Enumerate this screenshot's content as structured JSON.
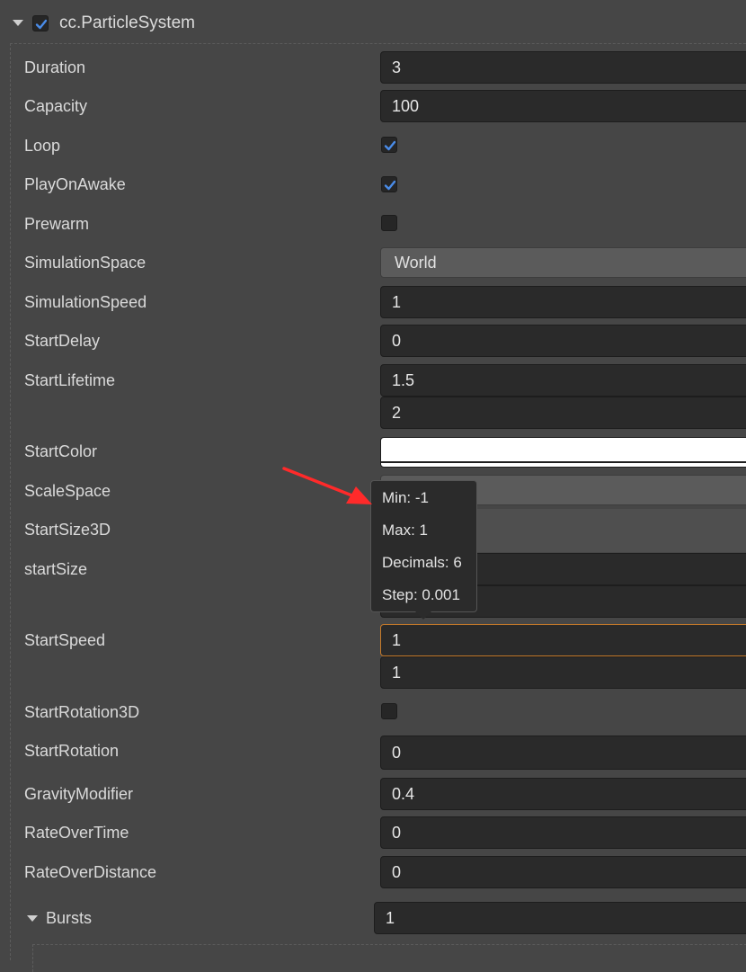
{
  "component": {
    "title": "cc.ParticleSystem",
    "enabled": true
  },
  "properties": {
    "duration": {
      "label": "Duration",
      "value": "3"
    },
    "capacity": {
      "label": "Capacity",
      "value": "100"
    },
    "loop": {
      "label": "Loop",
      "checked": true
    },
    "play_on_awake": {
      "label": "PlayOnAwake",
      "checked": true
    },
    "prewarm": {
      "label": "Prewarm",
      "checked": false
    },
    "simulation_space": {
      "label": "SimulationSpace",
      "value": "World"
    },
    "simulation_speed": {
      "label": "SimulationSpeed",
      "value": "1"
    },
    "start_delay": {
      "label": "StartDelay",
      "value": "0"
    },
    "start_lifetime": {
      "label": "StartLifetime",
      "min": "1.5",
      "max": "2"
    },
    "start_color": {
      "label": "StartColor",
      "color": "#ffffff"
    },
    "scale_space": {
      "label": "ScaleSpace"
    },
    "start_size_3d": {
      "label": "StartSize3D"
    },
    "start_size": {
      "label": "startSize"
    },
    "start_speed": {
      "label": "StartSpeed",
      "min": "1",
      "max": "1"
    },
    "start_rotation_3d": {
      "label": "StartRotation3D",
      "checked": false
    },
    "start_rotation": {
      "label": "StartRotation",
      "value": "0"
    },
    "gravity_modifier": {
      "label": "GravityModifier",
      "value": "0.4"
    },
    "rate_over_time": {
      "label": "RateOverTime",
      "value": "0"
    },
    "rate_over_distance": {
      "label": "RateOverDistance",
      "value": "0"
    },
    "bursts": {
      "label": "Bursts",
      "value": "1"
    }
  },
  "tooltip": {
    "min": "Min: -1",
    "max": "Max: 1",
    "decimals": "Decimals: 6",
    "step": "Step: 0.001"
  },
  "colors": {
    "background": "#464646",
    "field_bg": "#2a2a2a",
    "focus_border": "#c57a2a",
    "checkbox_check": "#4a8ce8",
    "annotation_arrow": "#ff2a2a"
  }
}
